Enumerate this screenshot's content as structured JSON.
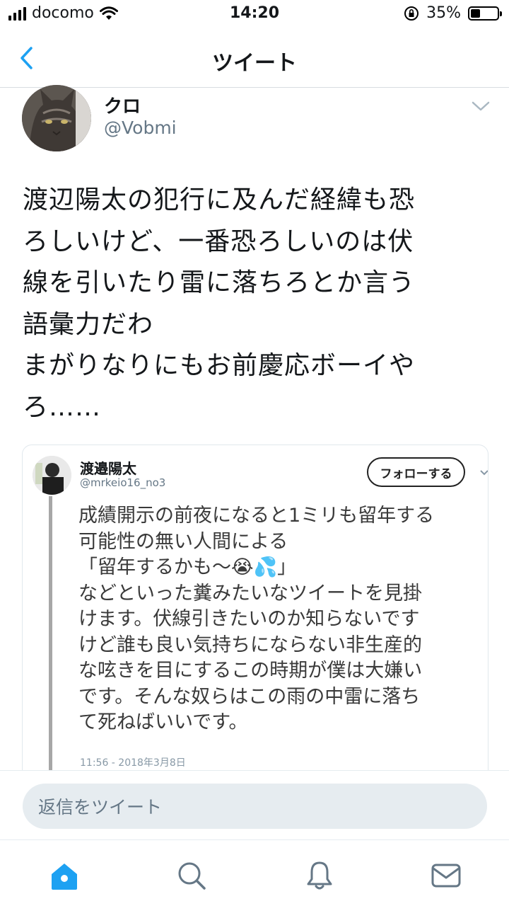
{
  "status_bar": {
    "carrier": "docomo",
    "time": "14:20",
    "battery": "35%",
    "battery_level": 0.35,
    "icons": [
      "signal-icon",
      "wifi-icon",
      "orientation-lock-icon",
      "battery-icon"
    ]
  },
  "nav": {
    "title": "ツイート",
    "back_icon": "chevron-left-icon"
  },
  "tweet": {
    "author_name": "クロ",
    "author_handle": "@Vobmi",
    "text": "渡辺陽太の犯行に及んだ経緯も恐\nろしいけど、一番恐ろしいのは伏\n線を引いたり雷に落ちろとか言う\n語彙力だわ\nまがりなりにもお前慶応ボーイや\nろ……"
  },
  "quoted": {
    "author_name": "渡邉陽太",
    "author_handle": "@mrkeio16_no3",
    "follow_label": "フォローする",
    "text": "成績開示の前夜になると1ミリも留年する\n可能性の無い人間による\n「留年するかも〜😭💦」\nなどといった糞みたいなツイートを見掛\nけます。伏線引きたいのか知らないです\nけど誰も良い気持ちにならない非生産的\nな呟きを目にするこの時期が僕は大嫌い\nです。そんな奴らはこの雨の中雷に落ち\nて死ねばいいです。",
    "timestamp": "11:56 - 2018年3月8日"
  },
  "reply": {
    "placeholder": "返信をツイート"
  },
  "tabs": [
    {
      "name": "home",
      "icon": "home-icon",
      "active": true
    },
    {
      "name": "search",
      "icon": "search-icon",
      "active": false
    },
    {
      "name": "notifications",
      "icon": "bell-icon",
      "active": false
    },
    {
      "name": "messages",
      "icon": "mail-icon",
      "active": false
    }
  ],
  "colors": {
    "accent": "#1da1f2",
    "secondary_text": "#657786",
    "icon_gray": "#657786"
  }
}
